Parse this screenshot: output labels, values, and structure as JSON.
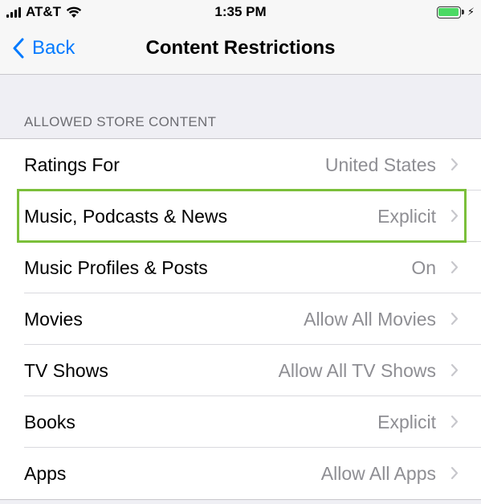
{
  "status_bar": {
    "carrier": "AT&T",
    "time": "1:35 PM",
    "battery_color": "#4cd964"
  },
  "nav": {
    "back_label": "Back",
    "title": "Content Restrictions",
    "accent_color": "#007aff"
  },
  "section": {
    "header": "ALLOWED STORE CONTENT"
  },
  "rows": [
    {
      "label": "Ratings For",
      "value": "United States"
    },
    {
      "label": "Music, Podcasts & News",
      "value": "Explicit",
      "highlighted": true
    },
    {
      "label": "Music Profiles & Posts",
      "value": "On"
    },
    {
      "label": "Movies",
      "value": "Allow All Movies"
    },
    {
      "label": "TV Shows",
      "value": "Allow All TV Shows"
    },
    {
      "label": "Books",
      "value": "Explicit"
    },
    {
      "label": "Apps",
      "value": "Allow All Apps"
    }
  ],
  "highlight_color": "#7bbf3a"
}
